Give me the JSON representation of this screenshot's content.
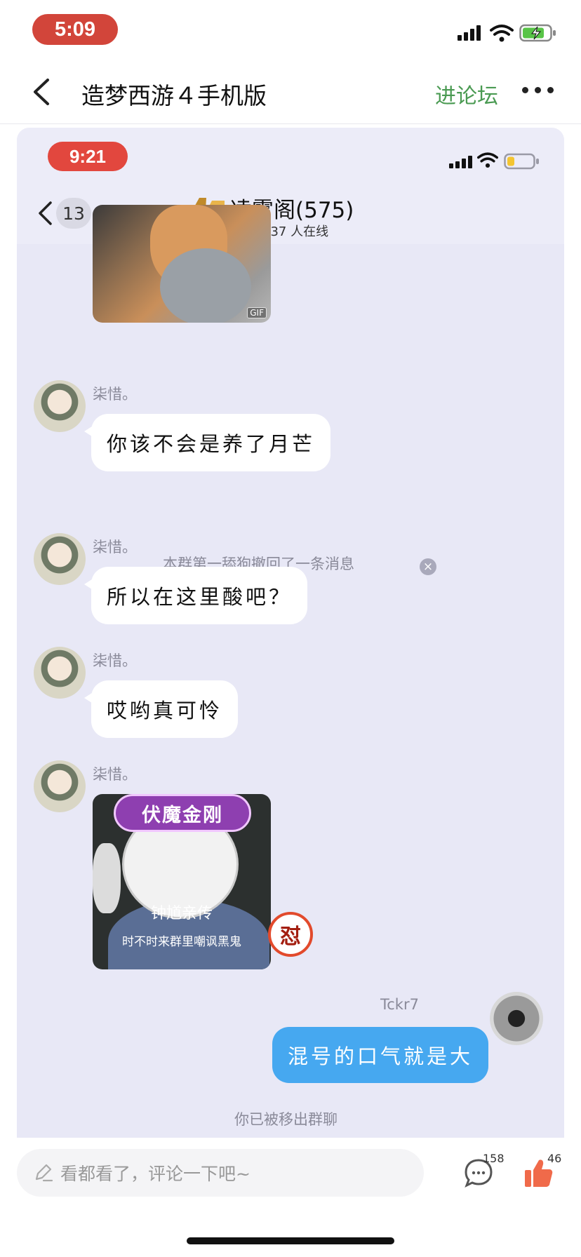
{
  "status": {
    "time": "5:09"
  },
  "header": {
    "title": "造梦西游４手机版",
    "forum_link": "进论坛"
  },
  "screenshot": {
    "status_time": "9:21",
    "back_count": "13",
    "group_name": "凌霄阁(575)",
    "online_text": "437 人在线",
    "messages": [
      {
        "sender": "柒惜。",
        "text": "你该不会是养了月芒"
      },
      {
        "system": "本群第一舔狗撤回了一条消息"
      },
      {
        "sender": "柒惜。",
        "text": "所以在这里酸吧？"
      },
      {
        "sender": "柒惜。",
        "text": "哎哟真可怜"
      },
      {
        "sender": "柒惜。",
        "sticker_title": "伏魔金刚",
        "sticker_line1": "钟馗亲传",
        "sticker_line2": "时不时来群里嘲讽黑鬼",
        "badge": "怼"
      },
      {
        "sender": "Tckr7",
        "text": "混号的口气就是大"
      }
    ],
    "gif_label": "GIF",
    "removed_notice": "你已被移出群聊"
  },
  "bottom_bar": {
    "comment_placeholder": "看都看了，评论一下吧~",
    "comment_count": "158",
    "like_count": "46"
  },
  "colors": {
    "accent_green": "#4a9a52",
    "time_pill": "#d2453a",
    "my_bubble": "#46a8f0",
    "like": "#f06a4a"
  }
}
